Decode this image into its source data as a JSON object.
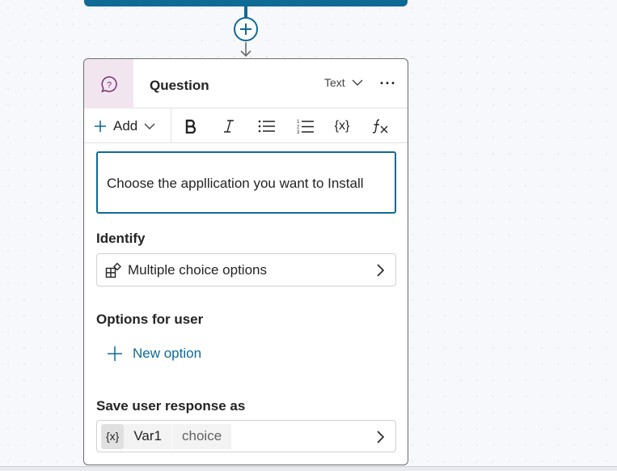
{
  "node": {
    "title": "Question",
    "type_label": "Text",
    "more_label": "···"
  },
  "toolbar": {
    "add_label": "Add",
    "variable_label": "{x}"
  },
  "message": {
    "text": "Choose the appllication you want to Install"
  },
  "identify": {
    "label": "Identify",
    "value": "Multiple choice options"
  },
  "options": {
    "label": "Options for user",
    "new_option_label": "New option"
  },
  "save_response": {
    "label": "Save user response as",
    "var_icon": "{x}",
    "var_name": "Var1",
    "var_type": "choice"
  },
  "colors": {
    "accent": "#0f6a96",
    "node_icon_bg": "#f1e6f0",
    "node_icon": "#7a2e73"
  },
  "icons": [
    "plus-icon",
    "arrow-down-icon",
    "question-chat-icon",
    "chevron-down-icon",
    "more-icon",
    "bold-icon",
    "italic-icon",
    "bullet-list-icon",
    "numbered-list-icon",
    "variable-icon",
    "formula-icon",
    "shapes-icon",
    "chevron-right-icon"
  ]
}
